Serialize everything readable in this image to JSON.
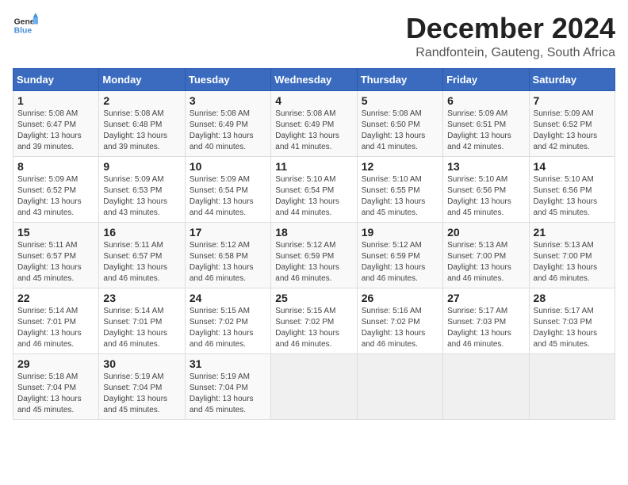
{
  "header": {
    "logo_line1": "General",
    "logo_line2": "Blue",
    "title": "December 2024",
    "subtitle": "Randfontein, Gauteng, South Africa"
  },
  "weekdays": [
    "Sunday",
    "Monday",
    "Tuesday",
    "Wednesday",
    "Thursday",
    "Friday",
    "Saturday"
  ],
  "weeks": [
    [
      {
        "day": "1",
        "rise": "5:08 AM",
        "set": "6:47 PM",
        "daylight": "13 hours and 39 minutes."
      },
      {
        "day": "2",
        "rise": "5:08 AM",
        "set": "6:48 PM",
        "daylight": "13 hours and 39 minutes."
      },
      {
        "day": "3",
        "rise": "5:08 AM",
        "set": "6:49 PM",
        "daylight": "13 hours and 40 minutes."
      },
      {
        "day": "4",
        "rise": "5:08 AM",
        "set": "6:49 PM",
        "daylight": "13 hours and 41 minutes."
      },
      {
        "day": "5",
        "rise": "5:08 AM",
        "set": "6:50 PM",
        "daylight": "13 hours and 41 minutes."
      },
      {
        "day": "6",
        "rise": "5:09 AM",
        "set": "6:51 PM",
        "daylight": "13 hours and 42 minutes."
      },
      {
        "day": "7",
        "rise": "5:09 AM",
        "set": "6:52 PM",
        "daylight": "13 hours and 42 minutes."
      }
    ],
    [
      {
        "day": "8",
        "rise": "5:09 AM",
        "set": "6:52 PM",
        "daylight": "13 hours and 43 minutes."
      },
      {
        "day": "9",
        "rise": "5:09 AM",
        "set": "6:53 PM",
        "daylight": "13 hours and 43 minutes."
      },
      {
        "day": "10",
        "rise": "5:09 AM",
        "set": "6:54 PM",
        "daylight": "13 hours and 44 minutes."
      },
      {
        "day": "11",
        "rise": "5:10 AM",
        "set": "6:54 PM",
        "daylight": "13 hours and 44 minutes."
      },
      {
        "day": "12",
        "rise": "5:10 AM",
        "set": "6:55 PM",
        "daylight": "13 hours and 45 minutes."
      },
      {
        "day": "13",
        "rise": "5:10 AM",
        "set": "6:56 PM",
        "daylight": "13 hours and 45 minutes."
      },
      {
        "day": "14",
        "rise": "5:10 AM",
        "set": "6:56 PM",
        "daylight": "13 hours and 45 minutes."
      }
    ],
    [
      {
        "day": "15",
        "rise": "5:11 AM",
        "set": "6:57 PM",
        "daylight": "13 hours and 45 minutes."
      },
      {
        "day": "16",
        "rise": "5:11 AM",
        "set": "6:57 PM",
        "daylight": "13 hours and 46 minutes."
      },
      {
        "day": "17",
        "rise": "5:12 AM",
        "set": "6:58 PM",
        "daylight": "13 hours and 46 minutes."
      },
      {
        "day": "18",
        "rise": "5:12 AM",
        "set": "6:59 PM",
        "daylight": "13 hours and 46 minutes."
      },
      {
        "day": "19",
        "rise": "5:12 AM",
        "set": "6:59 PM",
        "daylight": "13 hours and 46 minutes."
      },
      {
        "day": "20",
        "rise": "5:13 AM",
        "set": "7:00 PM",
        "daylight": "13 hours and 46 minutes."
      },
      {
        "day": "21",
        "rise": "5:13 AM",
        "set": "7:00 PM",
        "daylight": "13 hours and 46 minutes."
      }
    ],
    [
      {
        "day": "22",
        "rise": "5:14 AM",
        "set": "7:01 PM",
        "daylight": "13 hours and 46 minutes."
      },
      {
        "day": "23",
        "rise": "5:14 AM",
        "set": "7:01 PM",
        "daylight": "13 hours and 46 minutes."
      },
      {
        "day": "24",
        "rise": "5:15 AM",
        "set": "7:02 PM",
        "daylight": "13 hours and 46 minutes."
      },
      {
        "day": "25",
        "rise": "5:15 AM",
        "set": "7:02 PM",
        "daylight": "13 hours and 46 minutes."
      },
      {
        "day": "26",
        "rise": "5:16 AM",
        "set": "7:02 PM",
        "daylight": "13 hours and 46 minutes."
      },
      {
        "day": "27",
        "rise": "5:17 AM",
        "set": "7:03 PM",
        "daylight": "13 hours and 46 minutes."
      },
      {
        "day": "28",
        "rise": "5:17 AM",
        "set": "7:03 PM",
        "daylight": "13 hours and 45 minutes."
      }
    ],
    [
      {
        "day": "29",
        "rise": "5:18 AM",
        "set": "7:04 PM",
        "daylight": "13 hours and 45 minutes."
      },
      {
        "day": "30",
        "rise": "5:19 AM",
        "set": "7:04 PM",
        "daylight": "13 hours and 45 minutes."
      },
      {
        "day": "31",
        "rise": "5:19 AM",
        "set": "7:04 PM",
        "daylight": "13 hours and 45 minutes."
      },
      null,
      null,
      null,
      null
    ]
  ],
  "labels": {
    "sunrise": "Sunrise:",
    "sunset": "Sunset:",
    "daylight": "Daylight:"
  }
}
